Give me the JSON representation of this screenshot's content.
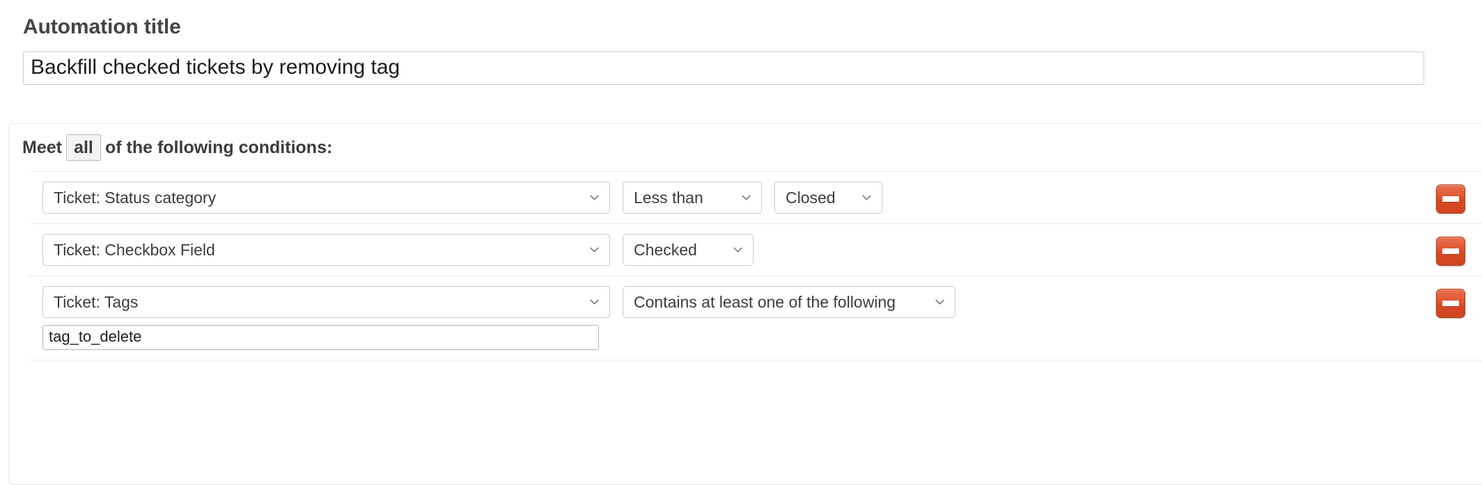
{
  "form": {
    "title_label": "Automation title",
    "title_value": "Backfill checked tickets by removing tag",
    "title_placeholder": "Automation title"
  },
  "conditions_panel": {
    "meet_prefix": "Meet",
    "match_type": "all",
    "meet_suffix": "of the following conditions:",
    "remove_button_label": "",
    "rows": [
      {
        "field": "Ticket: Status category",
        "operator": "Less than",
        "value": "Closed",
        "has_value_select": true,
        "has_text_input": false,
        "text_input_value": ""
      },
      {
        "field": "Ticket: Checkbox Field",
        "operator": "Checked",
        "value": "",
        "has_value_select": false,
        "has_text_input": false,
        "text_input_value": ""
      },
      {
        "field": "Ticket: Tags",
        "operator": "Contains at least one of the following",
        "value": "",
        "has_value_select": false,
        "has_text_input": true,
        "text_input_value": "tag_to_delete"
      }
    ]
  },
  "icons": {
    "chevron_down": "chevron-down-icon",
    "minus": "minus-icon"
  },
  "colors": {
    "remove_button": "#d74a24",
    "panel_border": "#e6e6e6",
    "input_border": "#cccccc",
    "text": "#3c3c3c"
  }
}
